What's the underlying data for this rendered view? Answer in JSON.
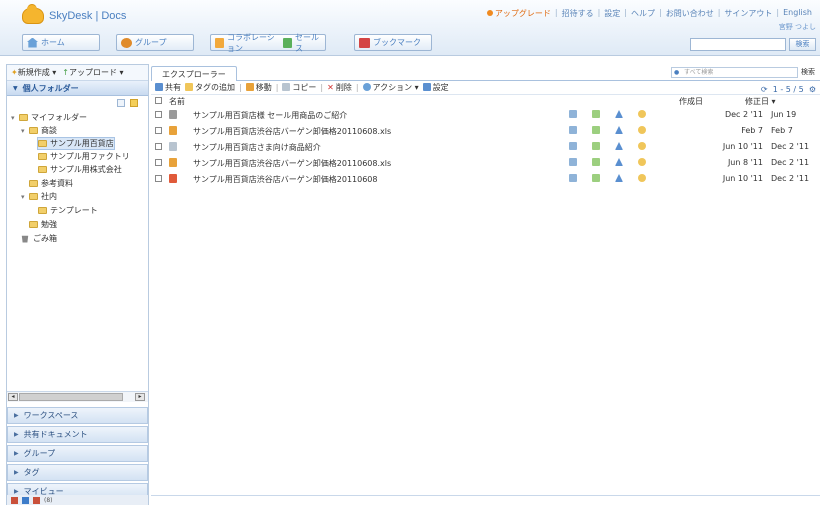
{
  "header": {
    "app_title": "SkyDesk | Docs",
    "links": [
      "アップグレード",
      "招待する",
      "設定",
      "ヘルプ",
      "お問い合わせ",
      "サインアウト",
      "English"
    ],
    "user_name": "宮野 つよし",
    "nav_buttons": [
      {
        "label": "ホーム",
        "icon": "home-icon"
      },
      {
        "label": "グループ",
        "icon": "group-icon"
      },
      {
        "label": "コラボレーション",
        "icon": "collaboration-icon"
      },
      {
        "label": "セールス",
        "icon": "sales-icon"
      },
      {
        "label": "ブックマーク",
        "icon": "bookmark-icon"
      }
    ],
    "search_value": "",
    "search_button": "検索"
  },
  "sidebar": {
    "toolbar": {
      "new_label": "新規作成",
      "upload_label": "アップロード"
    },
    "title": "個人フォルダー",
    "tree": [
      {
        "label": "マイフォルダー"
      },
      {
        "label": "商談"
      },
      {
        "label": "サンプル用百貨店"
      },
      {
        "label": "サンプル用ファクトリ"
      },
      {
        "label": "サンプル用株式会社"
      },
      {
        "label": "参考資料"
      },
      {
        "label": "社内"
      },
      {
        "label": "テンプレート"
      },
      {
        "label": "勉強"
      },
      {
        "label": "ごみ箱"
      }
    ],
    "accordion": [
      "ワークスペース",
      "共有ドキュメント",
      "グループ",
      "タグ",
      "マイビュー"
    ],
    "bottom_count": "(8)"
  },
  "main": {
    "tab": "エクスプローラー",
    "search_placeholder": "すべて検索",
    "search_button": "検索",
    "actions": [
      "共有",
      "タグの追加",
      "移動",
      "コピー",
      "削除",
      "アクション",
      "設定"
    ],
    "pager": "1 - 5 / 5",
    "columns": {
      "name": "名前",
      "created": "作成日",
      "modified": "修正日"
    },
    "rows": [
      {
        "name": "サンプル用百貨店様 セール用商品のご紹介",
        "created": "Dec 2 '11",
        "modified": "Jun 19",
        "icon_color": "#9a9a9a"
      },
      {
        "name": "サンプル用百貨店渋谷店バーゲン卸価格20110608.xls",
        "created": "Feb 7",
        "modified": "Feb 7",
        "icon_color": "#e8a23a"
      },
      {
        "name": "サンプル用百貨店さま向け商品紹介",
        "created": "Jun 10 '11",
        "modified": "Dec 2 '11",
        "icon_color": "#b8c4d0"
      },
      {
        "name": "サンプル用百貨店渋谷店バーゲン卸価格20110608.xls",
        "created": "Jun 8 '11",
        "modified": "Dec 2 '11",
        "icon_color": "#e8a23a"
      },
      {
        "name": "サンプル用百貨店渋谷店バーゲン卸価格20110608",
        "created": "Jun 10 '11",
        "modified": "Dec 2 '11",
        "icon_color": "#e05a3a"
      }
    ]
  }
}
